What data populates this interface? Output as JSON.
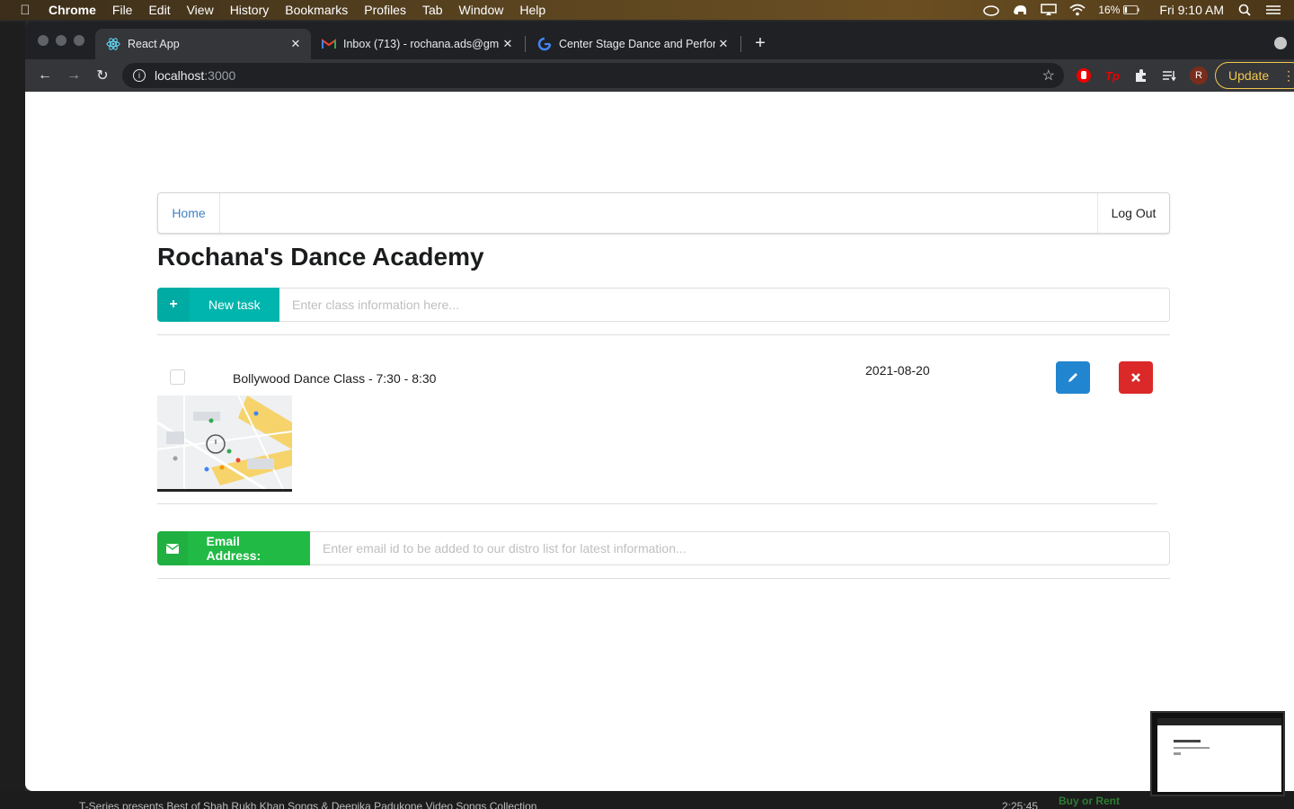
{
  "menubar": {
    "app": "Chrome",
    "items": [
      "File",
      "Edit",
      "View",
      "History",
      "Bookmarks",
      "Profiles",
      "Tab",
      "Window",
      "Help"
    ],
    "battery": "16%",
    "clock": "Fri 9:10 AM"
  },
  "browser": {
    "tabs": [
      {
        "title": "React App",
        "active": true
      },
      {
        "title": "Inbox (713) - rochana.ads@gm",
        "active": false
      },
      {
        "title": "Center Stage Dance and Perfor",
        "active": false
      }
    ],
    "url_host": "localhost",
    "url_port": ":3000",
    "profile_initial": "R",
    "update_label": "Update"
  },
  "nav": {
    "home": "Home",
    "logout": "Log Out"
  },
  "page_title": "Rochana's Dance Academy",
  "new_task": {
    "button_label": "New task",
    "placeholder": "Enter class information here..."
  },
  "tasks": [
    {
      "label": "Bollywood Dance Class - 7:30 - 8:30",
      "date": "2021-08-20"
    }
  ],
  "email": {
    "button_label": "Email Address:",
    "placeholder": "Enter email id to be added to our distro list for latest information..."
  },
  "desktop": {
    "bottom_text": "T-Series presents Best of Shah Rukh Khan Songs & Deepika Padukone Video Songs Collection",
    "duration": "2:25:45",
    "buy_label": "Buy or Rent"
  },
  "colors": {
    "teal": "#00b5ad",
    "green": "#21ba45",
    "blue": "#2185d0",
    "red": "#db2828",
    "link": "#4183c4"
  }
}
